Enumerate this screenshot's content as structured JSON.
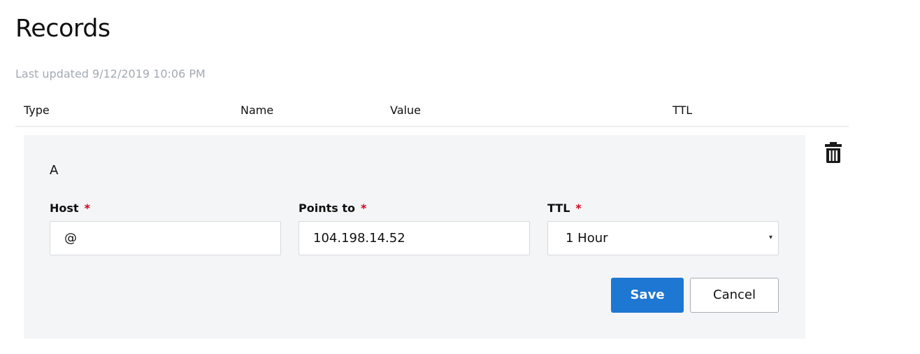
{
  "page": {
    "title": "Records",
    "last_updated": "Last updated 9/12/2019 10:06 PM"
  },
  "table": {
    "columns": [
      "Type",
      "Name",
      "Value",
      "TTL"
    ]
  },
  "record": {
    "type": "A",
    "host_label": "Host",
    "points_to_label": "Points to",
    "ttl_label": "TTL",
    "required_marker": "*",
    "host_value": "@",
    "points_to_value": "104.198.14.52",
    "ttl_value": "1 Hour",
    "save_label": "Save",
    "cancel_label": "Cancel"
  },
  "icons": {
    "delete": "trash-icon",
    "select_caret": "caret-down-icon"
  },
  "colors": {
    "primary_button": "#1e77d3",
    "required": "#d0021b",
    "panel_background": "#f4f5f6",
    "muted_text": "#a3aab4"
  }
}
